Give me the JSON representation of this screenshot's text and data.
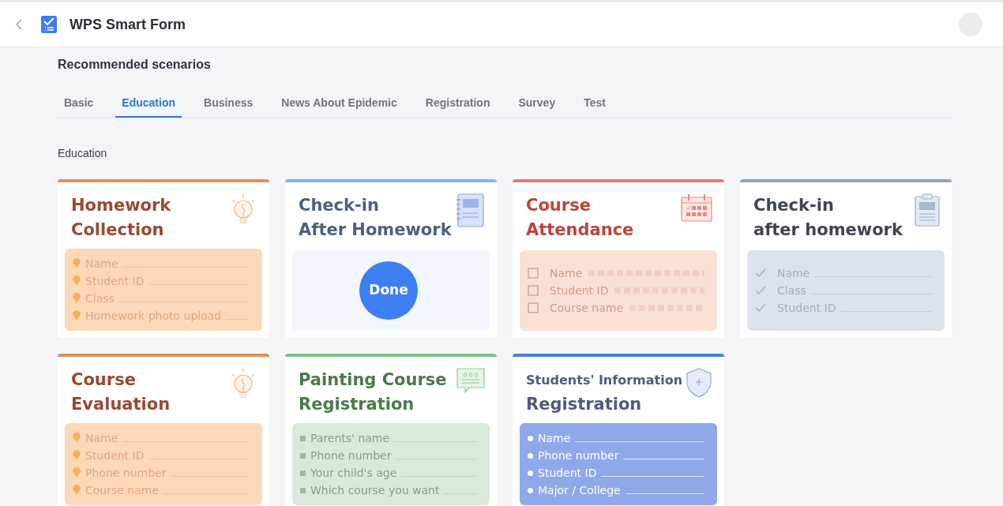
{
  "header": {
    "title": "WPS Smart Form"
  },
  "section_title": "Recommended scenarios",
  "tabs": [
    {
      "label": "Basic",
      "selected": false
    },
    {
      "label": "Education",
      "selected": true
    },
    {
      "label": "Business",
      "selected": false
    },
    {
      "label": "News About Epidemic",
      "selected": false
    },
    {
      "label": "Registration",
      "selected": false
    },
    {
      "label": "Survey",
      "selected": false
    },
    {
      "label": "Test",
      "selected": false
    }
  ],
  "category_title": "Education",
  "templates": [
    {
      "title": [
        "Homework",
        "Collection"
      ],
      "color": "#e0915a",
      "kind": "list",
      "fields": [
        "Name",
        "Student ID",
        "Class",
        "Homework photo upload"
      ]
    },
    {
      "title": [
        "Check-in",
        "After Homework"
      ],
      "color": "#8faee8",
      "kind": "done",
      "button": "Done"
    },
    {
      "title": [
        "Course",
        "Attendance"
      ],
      "color": "#e27b74",
      "kind": "list",
      "fields": [
        "Name",
        "Student ID",
        "Course name"
      ]
    },
    {
      "title": [
        "Check-in",
        "after homework"
      ],
      "color": "#90a4b8",
      "kind": "list",
      "fields": [
        "Name",
        "Class",
        "Student ID"
      ]
    },
    {
      "title": [
        "Course",
        "Evaluation"
      ],
      "color": "#e0915a",
      "kind": "list",
      "fields": [
        "Name",
        "Student ID",
        "Phone number",
        "Course name"
      ]
    },
    {
      "title": [
        "Painting Course",
        "Registration"
      ],
      "color": "#7cc27f",
      "kind": "list",
      "fields": [
        "Parents' name",
        "Phone number",
        "Your child's age",
        "Which course you want"
      ]
    },
    {
      "title": [
        "Students' Information",
        "Registration"
      ],
      "color": "#4a7fe0",
      "kind": "list",
      "fields": [
        "Name",
        "Phone number",
        "Student ID",
        "Major / College"
      ]
    }
  ]
}
